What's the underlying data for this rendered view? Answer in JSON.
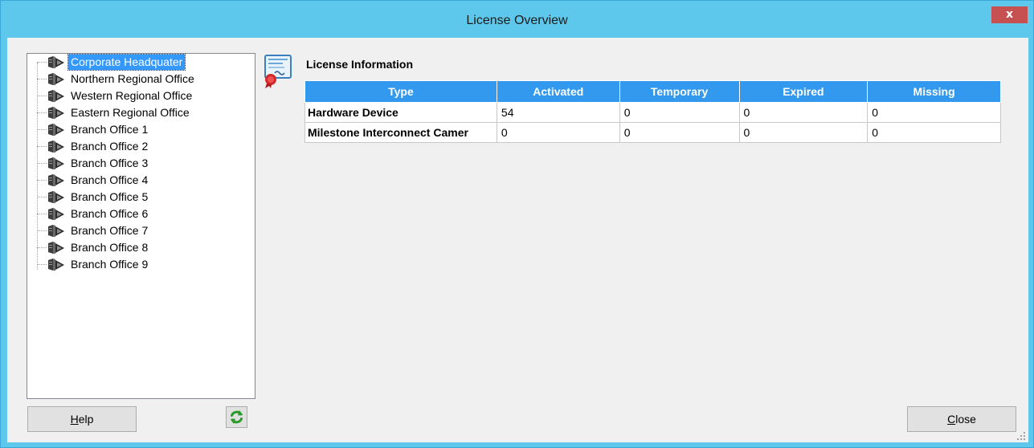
{
  "window": {
    "title": "License Overview",
    "close_glyph": "x"
  },
  "tree": {
    "items": [
      {
        "label": "Corporate Headquater",
        "icon": "server-icon",
        "selected": true
      },
      {
        "label": "Northern Regional Office",
        "icon": "server-icon"
      },
      {
        "label": "Western Regional Office",
        "icon": "server-icon"
      },
      {
        "label": "Eastern Regional Office",
        "icon": "server-icon"
      },
      {
        "label": "Branch Office 1",
        "icon": "server-icon"
      },
      {
        "label": "Branch Office 2",
        "icon": "server-icon"
      },
      {
        "label": "Branch Office 3",
        "icon": "server-icon"
      },
      {
        "label": "Branch Office 4",
        "icon": "server-icon"
      },
      {
        "label": "Branch Office 5",
        "icon": "server-icon"
      },
      {
        "label": "Branch Office 6",
        "icon": "server-icon"
      },
      {
        "label": "Branch Office 7",
        "icon": "server-icon"
      },
      {
        "label": "Branch Office 8",
        "icon": "server-icon"
      },
      {
        "label": "Branch Office 9",
        "icon": "server-icon"
      }
    ]
  },
  "license": {
    "title": "License Information",
    "icon": "certificate-icon",
    "columns": [
      "Type",
      "Activated",
      "Temporary",
      "Expired",
      "Missing"
    ],
    "rows": [
      {
        "type": "Hardware Device",
        "activated": "54",
        "temporary": "0",
        "expired": "0",
        "missing": "0"
      },
      {
        "type": "Milestone Interconnect Camer",
        "activated": "0",
        "temporary": "0",
        "expired": "0",
        "missing": "0"
      }
    ]
  },
  "buttons": {
    "help_first": "H",
    "help_rest": "elp",
    "close_first": "C",
    "close_rest": "lose",
    "refresh_icon": "refresh-icon"
  },
  "colors": {
    "titlebar": "#5ec8ec",
    "header": "#3399ee",
    "selection": "#3399ff",
    "close_button": "#c75050",
    "refresh_green": "#2a9a2a"
  }
}
